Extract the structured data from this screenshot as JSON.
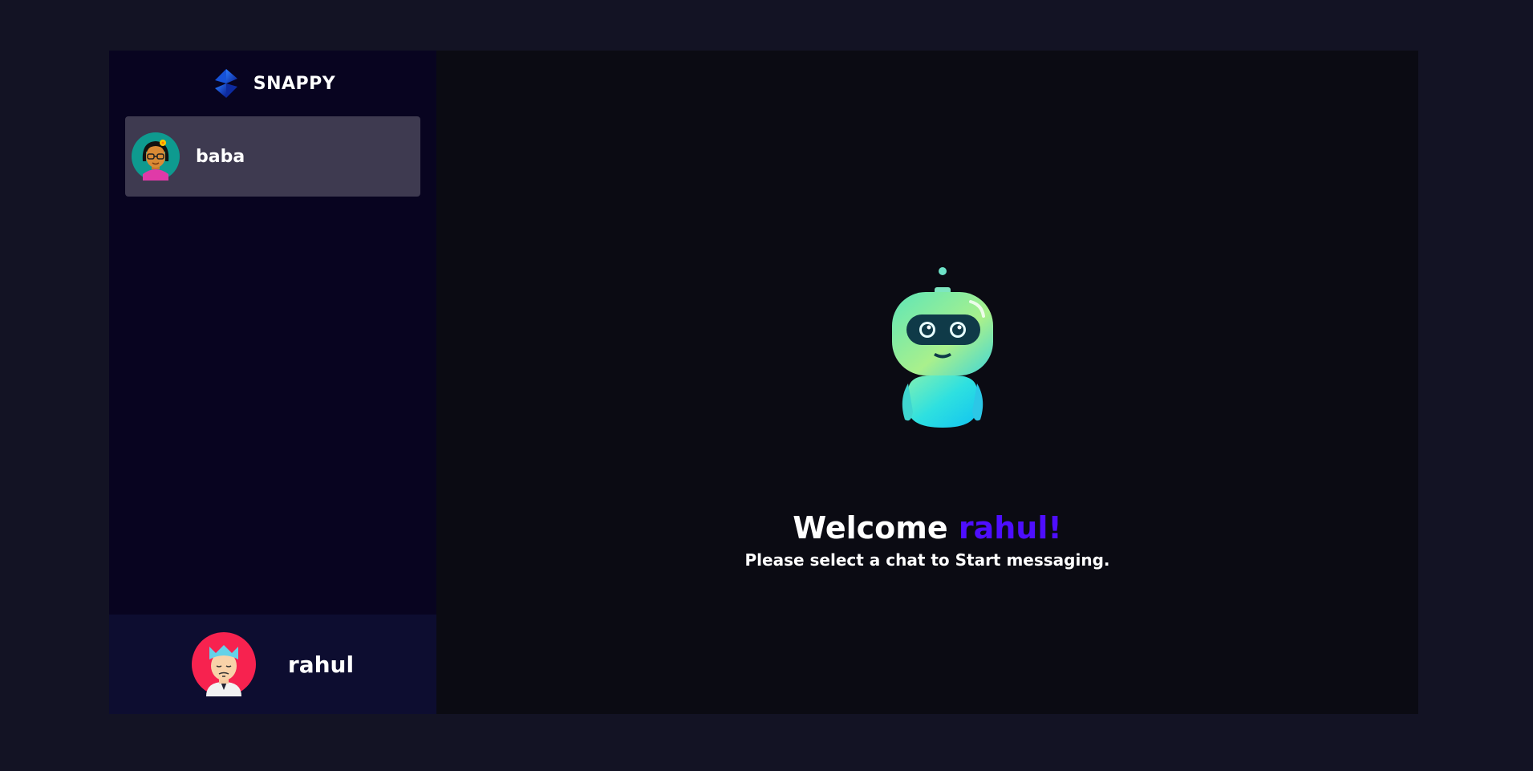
{
  "brand": {
    "name": "SNAPPY",
    "logo_icon": "snappy-logo-icon",
    "accent_color": "#4e0eff"
  },
  "contacts": [
    {
      "name": "baba",
      "avatar_icon": "woman-with-glasses-avatar-icon",
      "selected": true
    }
  ],
  "current_user": {
    "name": "rahul",
    "avatar_icon": "man-with-blue-hair-avatar-icon"
  },
  "welcome": {
    "greeting": "Welcome",
    "username": "rahul!",
    "subtitle": "Please select a chat to Start messaging.",
    "illustration_icon": "robot-icon"
  },
  "colors": {
    "background": "#131324",
    "sidebar": "#080420",
    "contact_selected": "#3e3a50",
    "current_user_bar": "#0d0d30",
    "main_panel": "#0b0b13",
    "highlight": "#4e0eff"
  }
}
